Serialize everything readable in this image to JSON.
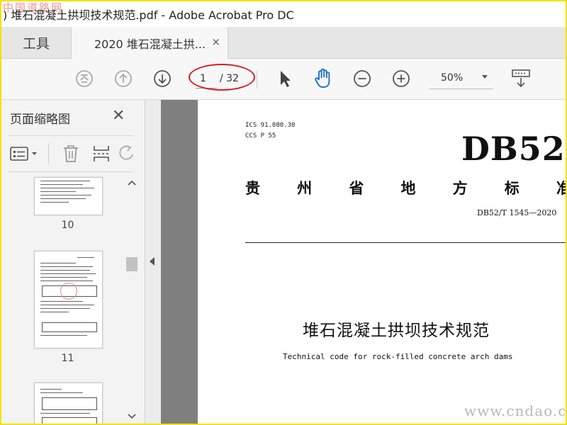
{
  "watermarks": {
    "top_left": "中国道路网",
    "bottom_right": "www.cndao.com"
  },
  "window": {
    "title": ") 堆石混凝土拱坝技术规范.pdf - Adobe Acrobat Pro DC"
  },
  "tabs": [
    {
      "label": "工具"
    },
    {
      "label": "2020 堆石混凝土拱...",
      "close": "×"
    }
  ],
  "toolbar": {
    "current_page": "1",
    "total_pages": "/ 32",
    "zoom": "50%"
  },
  "left_panel": {
    "title": "页面缩略图",
    "close": "✕",
    "thumbnails": [
      {
        "page_label": "10"
      },
      {
        "page_label": "11"
      }
    ]
  },
  "document": {
    "ics": "ICS 91.080.30",
    "ccs": "CCS P 55",
    "code": "DB52",
    "province_chars": [
      "贵",
      "州",
      "省",
      "地",
      "方",
      "标",
      "准"
    ],
    "standard_no": "DB52/T 1545—2020",
    "title_cn": "堆石混凝土拱坝技术规范",
    "title_en": "Technical code for rock-filled concrete arch dams"
  },
  "colors": {
    "accent_blue": "#1a73c8",
    "highlight_red": "#d02020",
    "frame_yellow": "#f2e200"
  },
  "icons": [
    "first-page-icon",
    "prev-page-icon",
    "next-page-icon",
    "select-arrow-icon",
    "hand-tool-icon",
    "zoom-out-icon",
    "zoom-in-icon",
    "read-mode-icon",
    "thumbnail-options-icon",
    "delete-icon",
    "insert-page-icon",
    "rotate-icon"
  ]
}
